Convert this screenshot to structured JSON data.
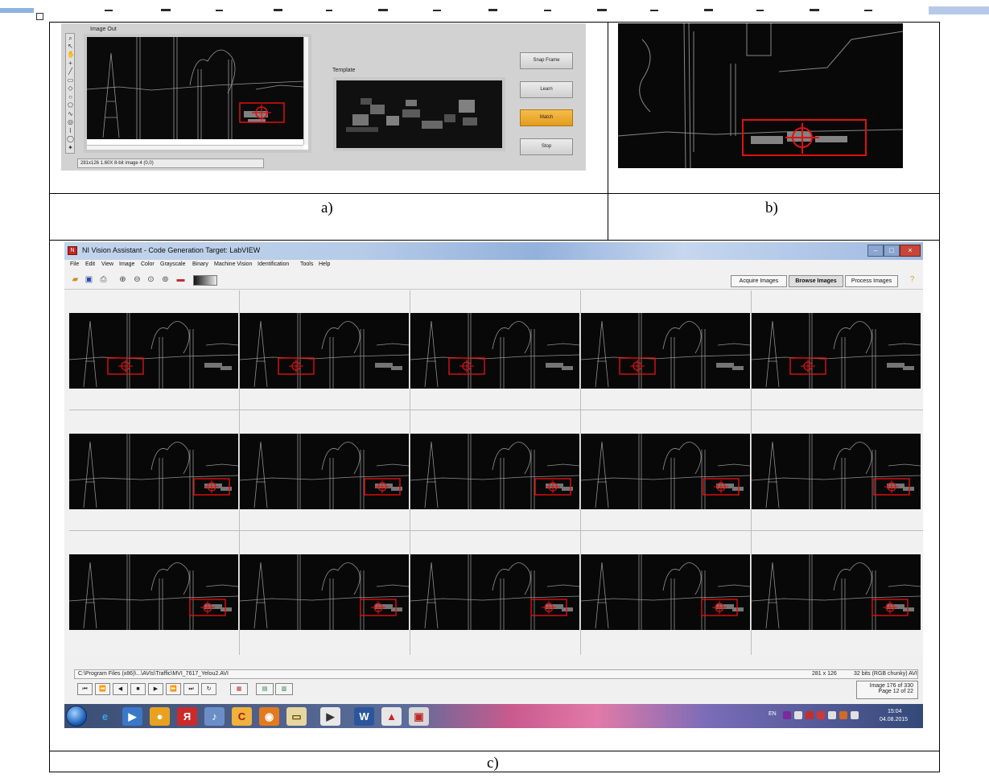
{
  "captions": {
    "a": "a)",
    "b": "b)",
    "c": "c)"
  },
  "panel_a": {
    "image_out_label": "Image Out",
    "template_label": "Template",
    "status_text": "281x126 1.60X 8-bit image 4    (0,0)",
    "buttons": {
      "snap": "Snap Frame",
      "learn": "Learn",
      "match": "Match",
      "stop": "Stop"
    },
    "colors": {
      "match_button": "#e9a52b",
      "match_box": "#e01010"
    }
  },
  "panel_c": {
    "window_title": "NI Vision Assistant - Code Generation Target: LabVIEW",
    "menu": [
      "File",
      "Edit",
      "View",
      "Image",
      "Color",
      "Grayscale",
      "Binary",
      "Machine Vision",
      "Identification",
      "Tools",
      "Help"
    ],
    "tabs": {
      "acquire": "Acquire Images",
      "browse": "Browse Images",
      "process": "Process Images"
    },
    "file_path": "C:\\Program Files (x86)\\...\\AVIs\\Traffic\\MVI_7617_Yelou2.AVI",
    "image_dims": "281 x 126",
    "image_format": "32 bits (RGB chunky)   AVI",
    "image_counter": "Image  176 of 330",
    "page_counter": "Page  12 of 22",
    "nav_glyphs": [
      "⏮",
      "⏪",
      "◀",
      "■",
      "▶",
      "⏩",
      "⏭",
      "↻"
    ],
    "tray_lang": "EN",
    "clock_time": "15:04",
    "clock_date": "04.08.2015"
  }
}
